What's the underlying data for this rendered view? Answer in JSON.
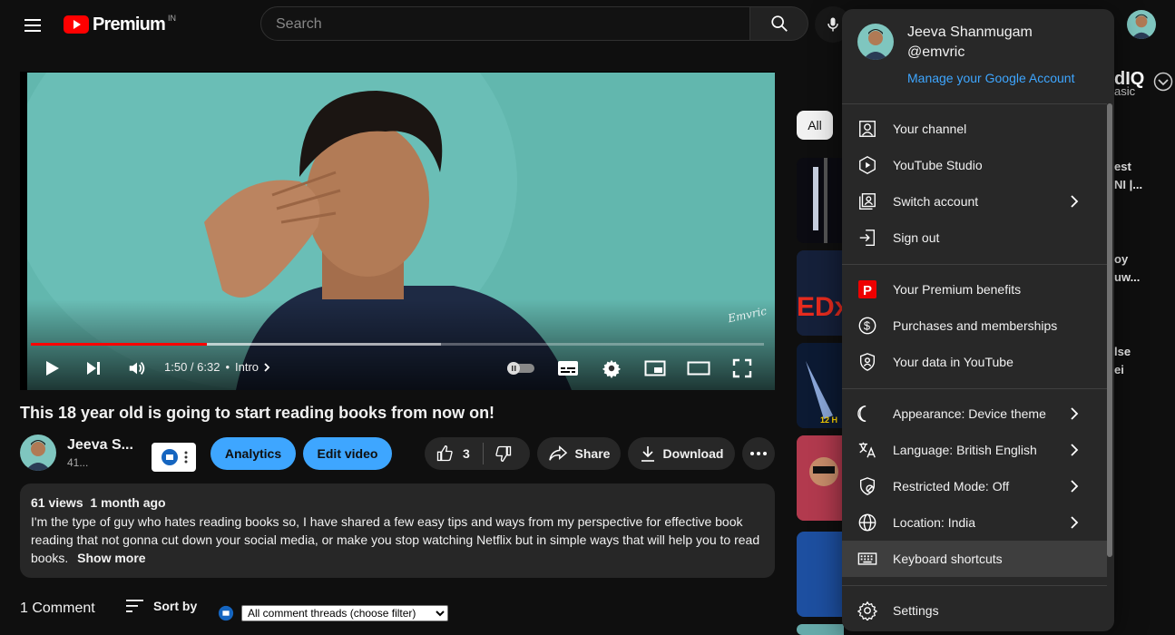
{
  "header": {
    "logo_word": "Premium",
    "logo_country": "IN",
    "search_placeholder": "Search"
  },
  "player": {
    "time": "1:50 / 6:32",
    "chapter": "Intro",
    "progress_played": 0.24,
    "progress_buffered": 0.56,
    "watermark": "Emvric"
  },
  "video": {
    "title": "This 18 year old is going to start reading books from now on!",
    "channel_name": "Jeeva S...",
    "channel_subs": "41...",
    "analytics_label": "Analytics",
    "edit_label": "Edit video",
    "like_count": "3",
    "share_label": "Share",
    "download_label": "Download"
  },
  "description": {
    "views": "61 views",
    "age": "1 month ago",
    "text": "I'm the type of guy who hates reading books so, I have shared a few easy tips and ways from my perspective for effective book reading that not gonna cut down your social media, or make you stop watching Netflix but in simple ways that will help you to read books.",
    "show_more": "Show more"
  },
  "comments": {
    "count_label": "1 Comment",
    "sort_label": "Sort by",
    "filter_value": "All comment threads (choose filter)"
  },
  "sidebar": {
    "chip_all": "All",
    "ext_logo_main": "dIQ",
    "ext_logo_sub": "asic",
    "fragments": [
      [
        "est",
        "NI |..."
      ],
      [
        "oy",
        "uw..."
      ],
      [
        "lse",
        "ei"
      ]
    ],
    "thumb_badge": "12 H"
  },
  "account_menu": {
    "name": "Jeeva Shanmugam",
    "handle": "@emvric",
    "manage": "Manage your Google Account",
    "items": [
      {
        "label": "Your channel",
        "icon": "person-box-icon",
        "chevron": false
      },
      {
        "label": "YouTube Studio",
        "icon": "studio-icon",
        "chevron": false
      },
      {
        "label": "Switch account",
        "icon": "switch-account-icon",
        "chevron": true
      },
      {
        "label": "Sign out",
        "icon": "sign-out-icon",
        "chevron": false
      },
      {
        "label": "Your Premium benefits",
        "icon": "premium-p-icon",
        "chevron": false
      },
      {
        "label": "Purchases and memberships",
        "icon": "dollar-icon",
        "chevron": false
      },
      {
        "label": "Your data in YouTube",
        "icon": "shield-person-icon",
        "chevron": false
      },
      {
        "label": "Appearance: Device theme",
        "icon": "moon-icon",
        "chevron": true
      },
      {
        "label": "Language: British English",
        "icon": "translate-icon",
        "chevron": true
      },
      {
        "label": "Restricted Mode: Off",
        "icon": "restricted-icon",
        "chevron": true
      },
      {
        "label": "Location: India",
        "icon": "globe-icon",
        "chevron": true
      },
      {
        "label": "Keyboard shortcuts",
        "icon": "keyboard-icon",
        "chevron": false
      },
      {
        "label": "Settings",
        "icon": "gear-icon",
        "chevron": false
      }
    ]
  },
  "colors": {
    "brand_red": "#ff0000",
    "link_blue": "#3ea6ff",
    "background": "#0f0f0f",
    "menu_bg": "#282828"
  }
}
